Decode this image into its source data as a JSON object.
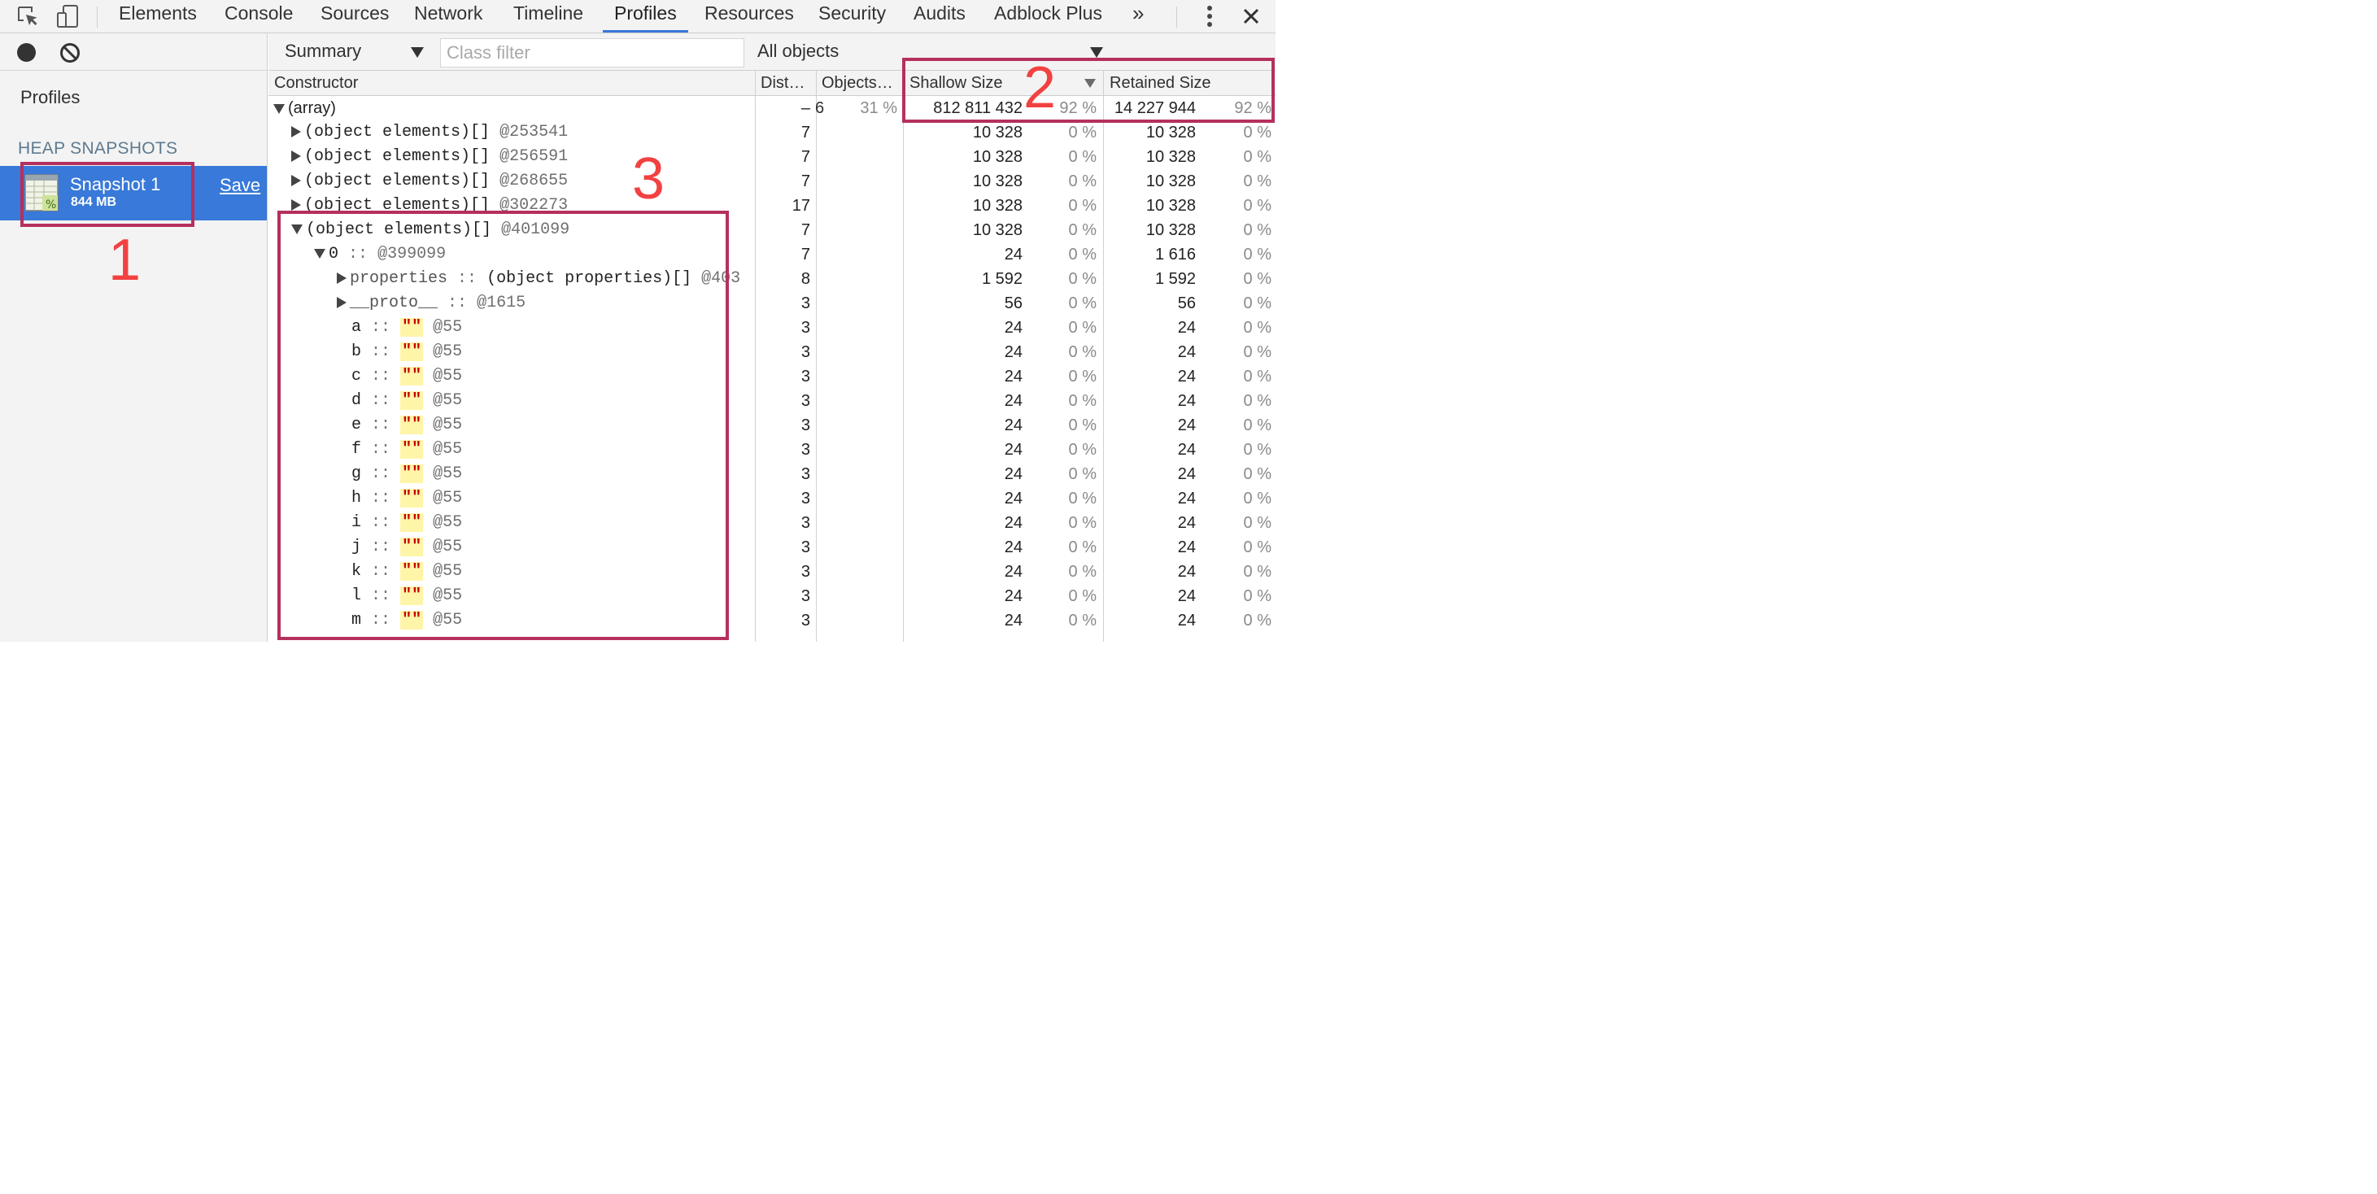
{
  "tabs": [
    "Elements",
    "Console",
    "Sources",
    "Network",
    "Timeline",
    "Profiles",
    "Resources",
    "Security",
    "Audits",
    "Adblock Plus"
  ],
  "active_tab": "Profiles",
  "more_tabs": "»",
  "sidebar": {
    "title": "Profiles",
    "section": "HEAP SNAPSHOTS",
    "snapshot": {
      "title": "Snapshot 1",
      "size": "844 MB",
      "save": "Save"
    }
  },
  "toolbar": {
    "view": "Summary",
    "class_filter_placeholder": "Class filter",
    "scope": "All objects"
  },
  "columns": {
    "constructor": "Constructor",
    "distance": "Dist…",
    "objects": "Objects…",
    "shallow": "Shallow Size",
    "retained": "Retained Size"
  },
  "top_row": {
    "label": "(array)",
    "distance": "–",
    "objects_count": "6",
    "objects_pct": "31 %",
    "shallow": "812 811 432",
    "shallow_pct": "92 %",
    "retained": "14 227 944",
    "retained_pct": "92 %"
  },
  "rows": [
    {
      "indent": 1,
      "expander": "closed",
      "name": "(object elements)[]",
      "sep": "",
      "obj": "",
      "oid": "@253541",
      "dist": "7",
      "shallow": "10 328",
      "spct": "0 %",
      "retained": "10 328",
      "rpct": "0 %"
    },
    {
      "indent": 1,
      "expander": "closed",
      "name": "(object elements)[]",
      "sep": "",
      "obj": "",
      "oid": "@256591",
      "dist": "7",
      "shallow": "10 328",
      "spct": "0 %",
      "retained": "10 328",
      "rpct": "0 %"
    },
    {
      "indent": 1,
      "expander": "closed",
      "name": "(object elements)[]",
      "sep": "",
      "obj": "",
      "oid": "@268655",
      "dist": "7",
      "shallow": "10 328",
      "spct": "0 %",
      "retained": "10 328",
      "rpct": "0 %"
    },
    {
      "indent": 1,
      "expander": "closed",
      "name": "(object elements)[]",
      "sep": "",
      "obj": "",
      "oid": "@302273",
      "dist": "17",
      "shallow": "10 328",
      "spct": "0 %",
      "retained": "10 328",
      "rpct": "0 %"
    },
    {
      "indent": 1,
      "expander": "open",
      "name": "(object elements)[]",
      "sep": "",
      "obj": "",
      "oid": "@401099",
      "dist": "7",
      "shallow": "10 328",
      "spct": "0 %",
      "retained": "10 328",
      "rpct": "0 %"
    },
    {
      "indent": 2,
      "expander": "open",
      "name": "0",
      "sep": "::",
      "obj": "",
      "oid": "@399099",
      "dist": "7",
      "shallow": "24",
      "spct": "0 %",
      "retained": "1 616",
      "rpct": "0 %"
    },
    {
      "indent": 3,
      "expander": "closed",
      "name": "properties",
      "sep": "::",
      "obj": "(object properties)[]",
      "oid": "@403",
      "dist": "8",
      "shallow": "1 592",
      "spct": "0 %",
      "retained": "1 592",
      "rpct": "0 %"
    },
    {
      "indent": 3,
      "expander": "closed",
      "name": "__proto__",
      "sep": "::",
      "obj": "",
      "oid": "@1615",
      "dist": "3",
      "shallow": "56",
      "spct": "0 %",
      "retained": "56",
      "rpct": "0 %"
    },
    {
      "indent": 3,
      "expander": "none",
      "name": "a",
      "sep": "::",
      "obj": "\"\"",
      "oid": "@55",
      "dist": "3",
      "shallow": "24",
      "spct": "0 %",
      "retained": "24",
      "rpct": "0 %"
    },
    {
      "indent": 3,
      "expander": "none",
      "name": "b",
      "sep": "::",
      "obj": "\"\"",
      "oid": "@55",
      "dist": "3",
      "shallow": "24",
      "spct": "0 %",
      "retained": "24",
      "rpct": "0 %"
    },
    {
      "indent": 3,
      "expander": "none",
      "name": "c",
      "sep": "::",
      "obj": "\"\"",
      "oid": "@55",
      "dist": "3",
      "shallow": "24",
      "spct": "0 %",
      "retained": "24",
      "rpct": "0 %"
    },
    {
      "indent": 3,
      "expander": "none",
      "name": "d",
      "sep": "::",
      "obj": "\"\"",
      "oid": "@55",
      "dist": "3",
      "shallow": "24",
      "spct": "0 %",
      "retained": "24",
      "rpct": "0 %"
    },
    {
      "indent": 3,
      "expander": "none",
      "name": "e",
      "sep": "::",
      "obj": "\"\"",
      "oid": "@55",
      "dist": "3",
      "shallow": "24",
      "spct": "0 %",
      "retained": "24",
      "rpct": "0 %"
    },
    {
      "indent": 3,
      "expander": "none",
      "name": "f",
      "sep": "::",
      "obj": "\"\"",
      "oid": "@55",
      "dist": "3",
      "shallow": "24",
      "spct": "0 %",
      "retained": "24",
      "rpct": "0 %"
    },
    {
      "indent": 3,
      "expander": "none",
      "name": "g",
      "sep": "::",
      "obj": "\"\"",
      "oid": "@55",
      "dist": "3",
      "shallow": "24",
      "spct": "0 %",
      "retained": "24",
      "rpct": "0 %"
    },
    {
      "indent": 3,
      "expander": "none",
      "name": "h",
      "sep": "::",
      "obj": "\"\"",
      "oid": "@55",
      "dist": "3",
      "shallow": "24",
      "spct": "0 %",
      "retained": "24",
      "rpct": "0 %"
    },
    {
      "indent": 3,
      "expander": "none",
      "name": "i",
      "sep": "::",
      "obj": "\"\"",
      "oid": "@55",
      "dist": "3",
      "shallow": "24",
      "spct": "0 %",
      "retained": "24",
      "rpct": "0 %"
    },
    {
      "indent": 3,
      "expander": "none",
      "name": "j",
      "sep": "::",
      "obj": "\"\"",
      "oid": "@55",
      "dist": "3",
      "shallow": "24",
      "spct": "0 %",
      "retained": "24",
      "rpct": "0 %"
    },
    {
      "indent": 3,
      "expander": "none",
      "name": "k",
      "sep": "::",
      "obj": "\"\"",
      "oid": "@55",
      "dist": "3",
      "shallow": "24",
      "spct": "0 %",
      "retained": "24",
      "rpct": "0 %"
    },
    {
      "indent": 3,
      "expander": "none",
      "name": "l",
      "sep": "::",
      "obj": "\"\"",
      "oid": "@55",
      "dist": "3",
      "shallow": "24",
      "spct": "0 %",
      "retained": "24",
      "rpct": "0 %"
    },
    {
      "indent": 3,
      "expander": "none",
      "name": "m",
      "sep": "::",
      "obj": "\"\"",
      "oid": "@55",
      "dist": "3",
      "shallow": "24",
      "spct": "0 %",
      "retained": "24",
      "rpct": "0 %"
    }
  ],
  "annotations": [
    "1",
    "2",
    "3"
  ],
  "colors": {
    "accent": "#3879d9",
    "annotation_box": "#b5305e",
    "annotation_number": "#f24141",
    "string_value": "#c80000"
  },
  "icons": [
    "inspect-element-icon",
    "device-mode-icon",
    "kebab-menu-icon",
    "close-icon",
    "record-icon",
    "clear-icon",
    "heap-snapshot-icon",
    "dropdown-arrow-icon",
    "sort-arrow-icon"
  ]
}
